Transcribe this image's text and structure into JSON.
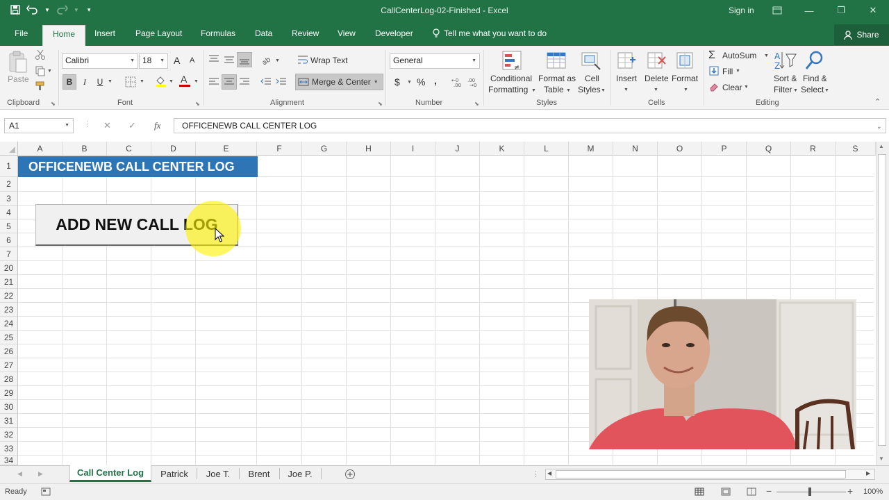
{
  "window": {
    "title": "CallCenterLog-02-Finished - Excel",
    "signin": "Sign in",
    "min_glyph": "—",
    "restore_glyph": "❐",
    "close_glyph": "✕"
  },
  "ribbon_tabs": {
    "items": [
      "File",
      "Home",
      "Insert",
      "Page Layout",
      "Formulas",
      "Data",
      "Review",
      "View",
      "Developer"
    ],
    "active": "Home",
    "tell_me": "Tell me what you want to do",
    "share": "Share"
  },
  "clipboard": {
    "paste": "Paste",
    "label": "Clipboard"
  },
  "font": {
    "name": "Calibri",
    "size": "18",
    "bold": "B",
    "italic": "I",
    "underline": "U",
    "grow": "A",
    "shrink": "A",
    "label": "Font",
    "accent_color": "#c00000"
  },
  "alignment": {
    "wrap_text": "Wrap Text",
    "merge_center": "Merge & Center",
    "label": "Alignment"
  },
  "number": {
    "format": "General",
    "currency": "$",
    "percent": "%",
    "comma": ",",
    "label": "Number"
  },
  "styles": {
    "conditional_1": "Conditional",
    "conditional_2": "Formatting",
    "format_table_1": "Format as",
    "format_table_2": "Table",
    "cell_styles_1": "Cell",
    "cell_styles_2": "Styles",
    "label": "Styles"
  },
  "cells": {
    "insert": "Insert",
    "delete": "Delete",
    "format": "Format",
    "label": "Cells"
  },
  "editing": {
    "autosum": "AutoSum",
    "fill": "Fill",
    "clear": "Clear",
    "sort_1": "Sort &",
    "sort_2": "Filter",
    "find_1": "Find &",
    "find_2": "Select",
    "label": "Editing"
  },
  "formula_bar": {
    "name_box": "A1",
    "fx": "fx",
    "content": "OFFICENEWB CALL CENTER LOG"
  },
  "grid": {
    "columns": [
      "A",
      "B",
      "C",
      "D",
      "E",
      "F",
      "G",
      "H",
      "I",
      "J",
      "K",
      "L",
      "M",
      "N",
      "O",
      "P",
      "Q",
      "R",
      "S"
    ],
    "rows": [
      "1",
      "2",
      "3",
      "4",
      "5",
      "6",
      "7",
      "20",
      "21",
      "22",
      "23",
      "24",
      "25",
      "26",
      "27",
      "28",
      "29",
      "30",
      "31",
      "32",
      "33",
      "34"
    ],
    "a1_value": "OFFICENEWB CALL CENTER LOG",
    "macro_button": "ADD NEW CALL LOG",
    "header_fill": "#2e75b6"
  },
  "sheets": {
    "tabs": [
      "Call Center Log",
      "Patrick",
      "Joe T.",
      "Brent",
      "Joe P."
    ],
    "active": "Call Center Log",
    "add_sheet_icon": "plus-circle-icon"
  },
  "status": {
    "mode": "Ready",
    "zoom": "100%",
    "minus": "−",
    "plus": "+"
  }
}
